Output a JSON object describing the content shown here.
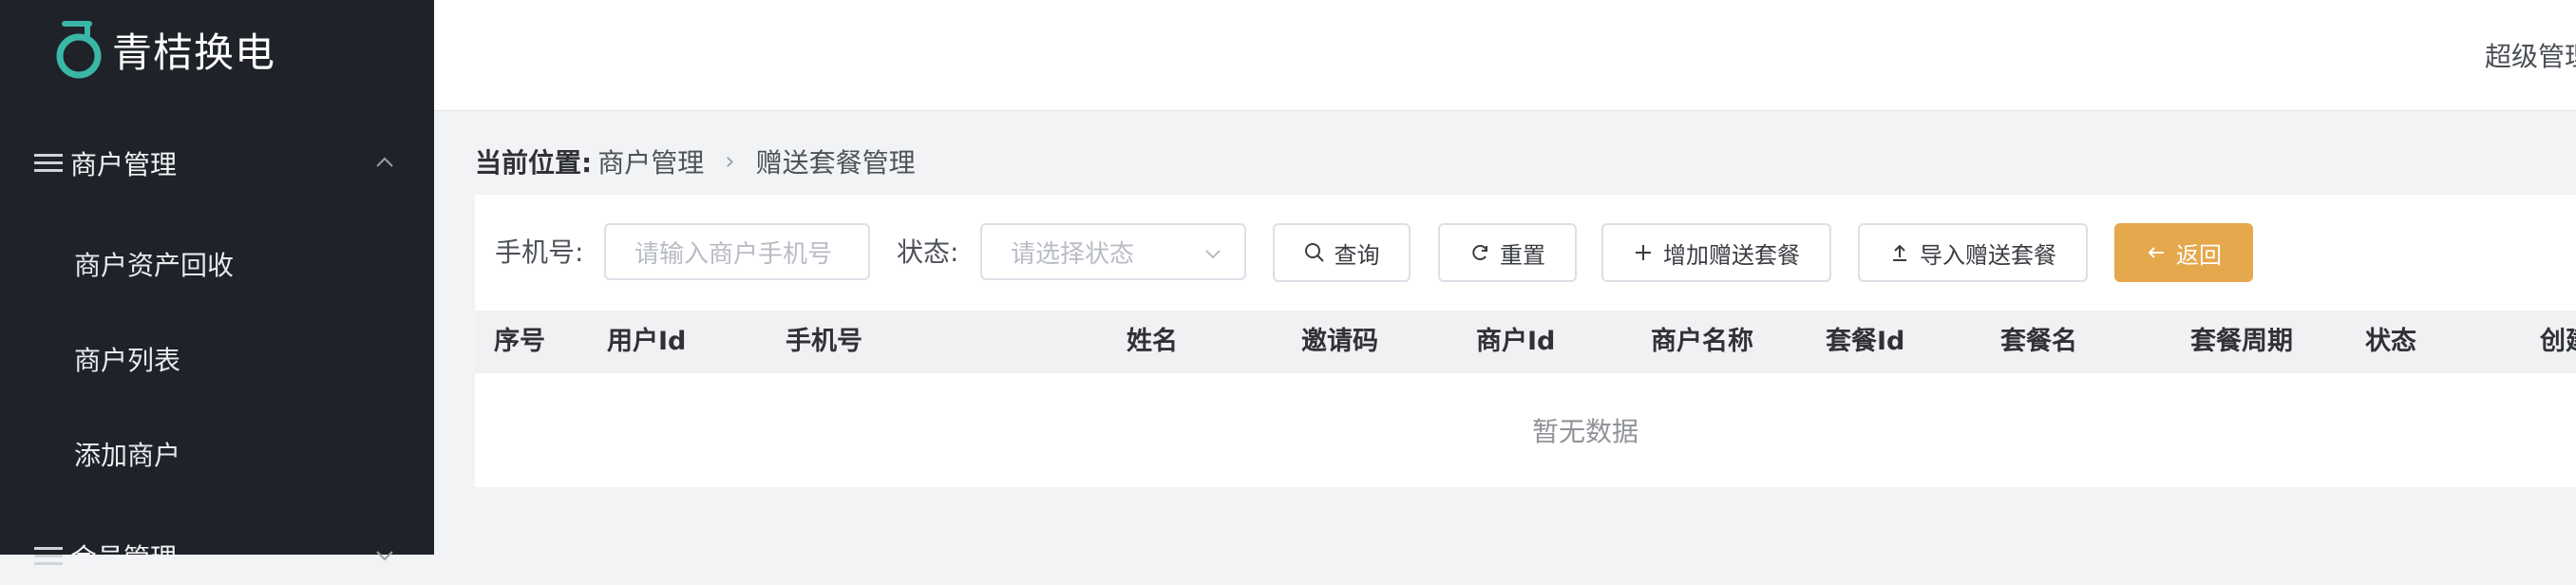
{
  "brand": {
    "name": "青桔换电"
  },
  "sidebar": {
    "groups": [
      {
        "label": "商户管理",
        "expanded": true,
        "items": [
          "商户资产回收",
          "商户列表",
          "添加商户"
        ]
      },
      {
        "label": "会员管理",
        "expanded": false
      }
    ]
  },
  "header": {
    "user": "超级管理"
  },
  "breadcrumb": {
    "label": "当前位置:",
    "items": [
      "商户管理",
      "赠送套餐管理"
    ]
  },
  "filters": {
    "phone_label": "手机号:",
    "phone_placeholder": "请输入商户手机号",
    "status_label": "状态:",
    "status_placeholder": "请选择状态"
  },
  "buttons": {
    "query": "查询",
    "reset": "重置",
    "add": "增加赠送套餐",
    "import": "导入赠送套餐",
    "back": "返回"
  },
  "table": {
    "columns": [
      "序号",
      "用户Id",
      "手机号",
      "姓名",
      "邀请码",
      "商户Id",
      "商户名称",
      "套餐Id",
      "套餐名",
      "套餐周期",
      "状态",
      "创建"
    ],
    "empty_text": "暂无数据"
  },
  "colors": {
    "sidebar_bg": "#1f2229",
    "accent": "#e6a84c",
    "logo": "#3ab7a6"
  }
}
